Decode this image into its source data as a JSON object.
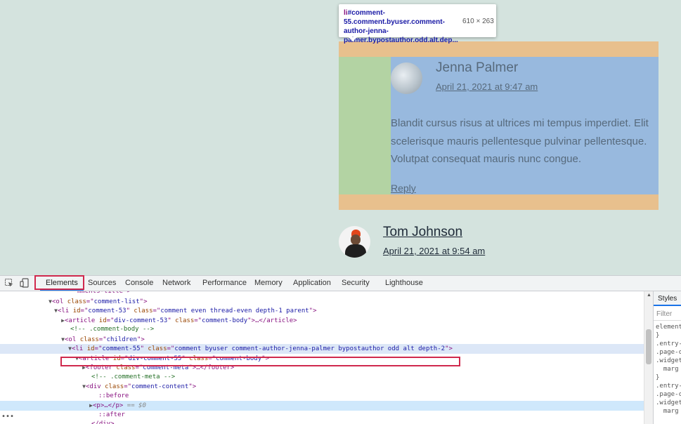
{
  "page": {
    "tooltip": {
      "selector_tag": "li",
      "selector_rest": "#comment-55.comment.byuser.comment-author-jenna-palmer.bypostauthor.odd.alt.dep...",
      "dimensions": "610 × 263"
    },
    "comment1": {
      "author": "Jenna Palmer",
      "date": "April 21, 2021 at 9:47 am",
      "text": "Blandit cursus risus at ultrices mi tempus imperdiet. Elit scelerisque mauris pellentesque pulvinar pellentesque. Volutpat consequat mauris nunc congue.",
      "reply": "Reply"
    },
    "comment2": {
      "author": "Tom Johnson",
      "date": "April 21, 2021 at 9:54 am"
    }
  },
  "devtools": {
    "tabs": [
      "Elements",
      "Sources",
      "Console",
      "Network",
      "Performance",
      "Memory",
      "Application",
      "Security",
      "Lighthouse"
    ],
    "active_tab": "Elements",
    "tree": [
      {
        "indent": 74,
        "tri": "▼",
        "parts": [
          [
            "tg",
            "<ol "
          ],
          [
            "an",
            "class"
          ],
          [
            "tg",
            "=\""
          ],
          [
            "av",
            "comment-list"
          ],
          [
            "tg",
            "\">"
          ]
        ]
      },
      {
        "indent": 82,
        "tri": "▼",
        "parts": [
          [
            "tg",
            "<li "
          ],
          [
            "an",
            "id"
          ],
          [
            "tg",
            "=\""
          ],
          [
            "av",
            "comment-53"
          ],
          [
            "tg",
            "\" "
          ],
          [
            "an",
            "class"
          ],
          [
            "tg",
            "=\""
          ],
          [
            "av",
            "comment even thread-even depth-1 parent"
          ],
          [
            "tg",
            "\">"
          ]
        ]
      },
      {
        "indent": 92,
        "tri": "▶",
        "parts": [
          [
            "tg",
            "<article "
          ],
          [
            "an",
            "id"
          ],
          [
            "tg",
            "=\""
          ],
          [
            "av",
            "div-comment-53"
          ],
          [
            "tg",
            "\" "
          ],
          [
            "an",
            "class"
          ],
          [
            "tg",
            "=\""
          ],
          [
            "av",
            "comment-body"
          ],
          [
            "tg",
            "\">…</article>"
          ]
        ]
      },
      {
        "indent": 100,
        "tri": "",
        "parts": [
          [
            "cm",
            "<!-- .comment-body -->"
          ]
        ]
      },
      {
        "indent": 92,
        "tri": "▼",
        "parts": [
          [
            "tg",
            "<ol "
          ],
          [
            "an",
            "class"
          ],
          [
            "tg",
            "=\""
          ],
          [
            "av",
            "children"
          ],
          [
            "tg",
            "\">"
          ]
        ]
      },
      {
        "indent": 102,
        "tri": "▼",
        "parts": [
          [
            "tg",
            "<li "
          ],
          [
            "an",
            "id"
          ],
          [
            "tg",
            "=\""
          ],
          [
            "av",
            "comment-55"
          ],
          [
            "tg",
            "\" "
          ],
          [
            "an",
            "class"
          ],
          [
            "tg",
            "=\""
          ],
          [
            "av",
            "comment byuser comment-author-jenna-palmer bypostauthor odd alt depth-2"
          ],
          [
            "tg",
            "\">"
          ]
        ],
        "selected": true
      },
      {
        "indent": 112,
        "tri": "▼",
        "parts": [
          [
            "tg",
            "<article "
          ],
          [
            "an",
            "id"
          ],
          [
            "tg",
            "=\""
          ],
          [
            "av",
            "div-comment-55"
          ],
          [
            "tg",
            "\" "
          ],
          [
            "an",
            "class"
          ],
          [
            "tg",
            "=\""
          ],
          [
            "av",
            "comment-body"
          ],
          [
            "tg",
            "\">"
          ]
        ]
      },
      {
        "indent": 122,
        "tri": "▶",
        "parts": [
          [
            "tg",
            "<footer "
          ],
          [
            "an",
            "class"
          ],
          [
            "tg",
            "=\""
          ],
          [
            "av",
            "comment-meta"
          ],
          [
            "tg",
            "\">…</footer>"
          ]
        ]
      },
      {
        "indent": 130,
        "tri": "",
        "parts": [
          [
            "cm",
            "<!-- .comment-meta -->"
          ]
        ]
      },
      {
        "indent": 122,
        "tri": "▼",
        "parts": [
          [
            "tg",
            "<div "
          ],
          [
            "an",
            "class"
          ],
          [
            "tg",
            "=\""
          ],
          [
            "av",
            "comment-content"
          ],
          [
            "tg",
            "\">"
          ]
        ]
      },
      {
        "indent": 140,
        "tri": "",
        "parts": [
          [
            "ps",
            "::before"
          ]
        ]
      },
      {
        "indent": 132,
        "tri": "▶",
        "parts": [
          [
            "tg",
            "<p>…</p>"
          ],
          [
            "dl",
            " == $0"
          ]
        ],
        "hover": true
      },
      {
        "indent": 140,
        "tri": "",
        "parts": [
          [
            "ps",
            "::after"
          ]
        ]
      },
      {
        "indent": 130,
        "tri": "",
        "parts": [
          [
            "tg",
            "</div>"
          ]
        ]
      }
    ],
    "styles": {
      "tab": "Styles",
      "filter_placeholder": "Filter",
      "rules": "element\n}\n.entry-\n.page-c\n.widget\n  marg\n}\n.entry-\n.page-c\n.widget\n  marg"
    }
  }
}
